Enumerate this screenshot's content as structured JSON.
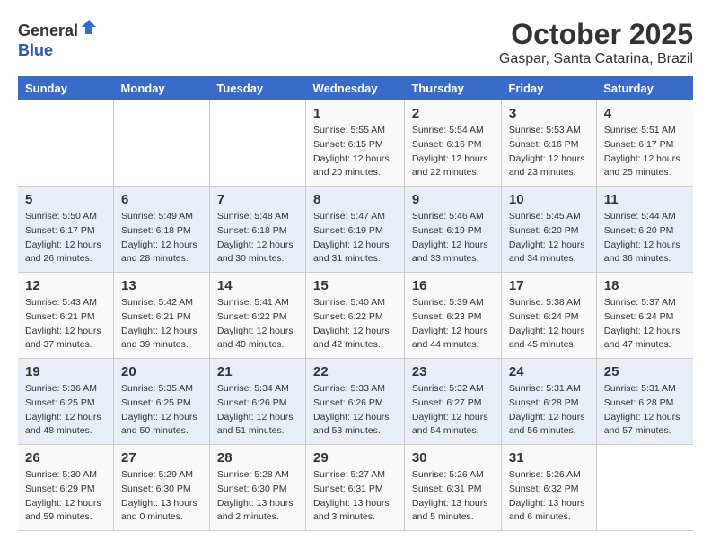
{
  "header": {
    "logo_line1": "General",
    "logo_line2": "Blue",
    "month": "October 2025",
    "location": "Gaspar, Santa Catarina, Brazil"
  },
  "days_of_week": [
    "Sunday",
    "Monday",
    "Tuesday",
    "Wednesday",
    "Thursday",
    "Friday",
    "Saturday"
  ],
  "weeks": [
    [
      {
        "day": "",
        "info": ""
      },
      {
        "day": "",
        "info": ""
      },
      {
        "day": "",
        "info": ""
      },
      {
        "day": "1",
        "info": "Sunrise: 5:55 AM\nSunset: 6:15 PM\nDaylight: 12 hours\nand 20 minutes."
      },
      {
        "day": "2",
        "info": "Sunrise: 5:54 AM\nSunset: 6:16 PM\nDaylight: 12 hours\nand 22 minutes."
      },
      {
        "day": "3",
        "info": "Sunrise: 5:53 AM\nSunset: 6:16 PM\nDaylight: 12 hours\nand 23 minutes."
      },
      {
        "day": "4",
        "info": "Sunrise: 5:51 AM\nSunset: 6:17 PM\nDaylight: 12 hours\nand 25 minutes."
      }
    ],
    [
      {
        "day": "5",
        "info": "Sunrise: 5:50 AM\nSunset: 6:17 PM\nDaylight: 12 hours\nand 26 minutes."
      },
      {
        "day": "6",
        "info": "Sunrise: 5:49 AM\nSunset: 6:18 PM\nDaylight: 12 hours\nand 28 minutes."
      },
      {
        "day": "7",
        "info": "Sunrise: 5:48 AM\nSunset: 6:18 PM\nDaylight: 12 hours\nand 30 minutes."
      },
      {
        "day": "8",
        "info": "Sunrise: 5:47 AM\nSunset: 6:19 PM\nDaylight: 12 hours\nand 31 minutes."
      },
      {
        "day": "9",
        "info": "Sunrise: 5:46 AM\nSunset: 6:19 PM\nDaylight: 12 hours\nand 33 minutes."
      },
      {
        "day": "10",
        "info": "Sunrise: 5:45 AM\nSunset: 6:20 PM\nDaylight: 12 hours\nand 34 minutes."
      },
      {
        "day": "11",
        "info": "Sunrise: 5:44 AM\nSunset: 6:20 PM\nDaylight: 12 hours\nand 36 minutes."
      }
    ],
    [
      {
        "day": "12",
        "info": "Sunrise: 5:43 AM\nSunset: 6:21 PM\nDaylight: 12 hours\nand 37 minutes."
      },
      {
        "day": "13",
        "info": "Sunrise: 5:42 AM\nSunset: 6:21 PM\nDaylight: 12 hours\nand 39 minutes."
      },
      {
        "day": "14",
        "info": "Sunrise: 5:41 AM\nSunset: 6:22 PM\nDaylight: 12 hours\nand 40 minutes."
      },
      {
        "day": "15",
        "info": "Sunrise: 5:40 AM\nSunset: 6:22 PM\nDaylight: 12 hours\nand 42 minutes."
      },
      {
        "day": "16",
        "info": "Sunrise: 5:39 AM\nSunset: 6:23 PM\nDaylight: 12 hours\nand 44 minutes."
      },
      {
        "day": "17",
        "info": "Sunrise: 5:38 AM\nSunset: 6:24 PM\nDaylight: 12 hours\nand 45 minutes."
      },
      {
        "day": "18",
        "info": "Sunrise: 5:37 AM\nSunset: 6:24 PM\nDaylight: 12 hours\nand 47 minutes."
      }
    ],
    [
      {
        "day": "19",
        "info": "Sunrise: 5:36 AM\nSunset: 6:25 PM\nDaylight: 12 hours\nand 48 minutes."
      },
      {
        "day": "20",
        "info": "Sunrise: 5:35 AM\nSunset: 6:25 PM\nDaylight: 12 hours\nand 50 minutes."
      },
      {
        "day": "21",
        "info": "Sunrise: 5:34 AM\nSunset: 6:26 PM\nDaylight: 12 hours\nand 51 minutes."
      },
      {
        "day": "22",
        "info": "Sunrise: 5:33 AM\nSunset: 6:26 PM\nDaylight: 12 hours\nand 53 minutes."
      },
      {
        "day": "23",
        "info": "Sunrise: 5:32 AM\nSunset: 6:27 PM\nDaylight: 12 hours\nand 54 minutes."
      },
      {
        "day": "24",
        "info": "Sunrise: 5:31 AM\nSunset: 6:28 PM\nDaylight: 12 hours\nand 56 minutes."
      },
      {
        "day": "25",
        "info": "Sunrise: 5:31 AM\nSunset: 6:28 PM\nDaylight: 12 hours\nand 57 minutes."
      }
    ],
    [
      {
        "day": "26",
        "info": "Sunrise: 5:30 AM\nSunset: 6:29 PM\nDaylight: 12 hours\nand 59 minutes."
      },
      {
        "day": "27",
        "info": "Sunrise: 5:29 AM\nSunset: 6:30 PM\nDaylight: 13 hours\nand 0 minutes."
      },
      {
        "day": "28",
        "info": "Sunrise: 5:28 AM\nSunset: 6:30 PM\nDaylight: 13 hours\nand 2 minutes."
      },
      {
        "day": "29",
        "info": "Sunrise: 5:27 AM\nSunset: 6:31 PM\nDaylight: 13 hours\nand 3 minutes."
      },
      {
        "day": "30",
        "info": "Sunrise: 5:26 AM\nSunset: 6:31 PM\nDaylight: 13 hours\nand 5 minutes."
      },
      {
        "day": "31",
        "info": "Sunrise: 5:26 AM\nSunset: 6:32 PM\nDaylight: 13 hours\nand 6 minutes."
      },
      {
        "day": "",
        "info": ""
      }
    ]
  ]
}
